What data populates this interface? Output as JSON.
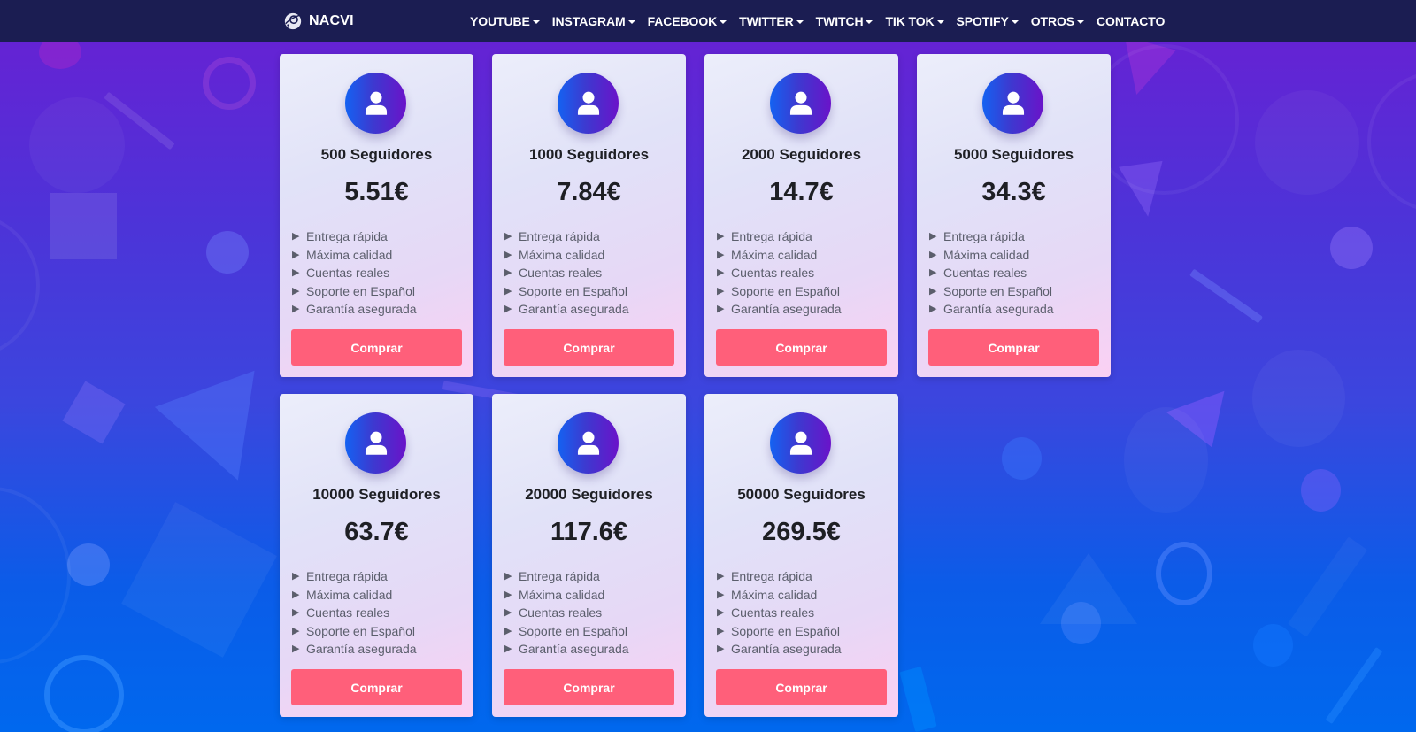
{
  "navbar": {
    "brand": {
      "icon": "planet-logo-icon",
      "label": "NACVI"
    },
    "links": [
      {
        "label": "YOUTUBE",
        "dropdown": true
      },
      {
        "label": "INSTAGRAM",
        "dropdown": true
      },
      {
        "label": "FACEBOOK",
        "dropdown": true
      },
      {
        "label": "TWITTER",
        "dropdown": true
      },
      {
        "label": "TWITCH",
        "dropdown": true
      },
      {
        "label": "TIK TOK",
        "dropdown": true
      },
      {
        "label": "SPOTIFY",
        "dropdown": true
      },
      {
        "label": "OTROS",
        "dropdown": true
      },
      {
        "label": "CONTACTO",
        "dropdown": false
      }
    ]
  },
  "colors": {
    "navbar_bg": "#1b1d52",
    "button": "#ff5f7a",
    "avatar_from": "#1462f2",
    "avatar_to": "#6a13c9"
  },
  "cards": [
    {
      "icon": "user-icon",
      "title": "500 Seguidores",
      "price": "5.51€",
      "features": [
        "Entrega rápida",
        "Máxima calidad",
        "Cuentas reales",
        "Soporte en Español",
        "Garantía asegurada"
      ],
      "button": "Comprar"
    },
    {
      "icon": "user-icon",
      "title": "1000 Seguidores",
      "price": "7.84€",
      "features": [
        "Entrega rápida",
        "Máxima calidad",
        "Cuentas reales",
        "Soporte en Español",
        "Garantía asegurada"
      ],
      "button": "Comprar"
    },
    {
      "icon": "user-icon",
      "title": "2000 Seguidores",
      "price": "14.7€",
      "features": [
        "Entrega rápida",
        "Máxima calidad",
        "Cuentas reales",
        "Soporte en Español",
        "Garantía asegurada"
      ],
      "button": "Comprar"
    },
    {
      "icon": "user-icon",
      "title": "5000 Seguidores",
      "price": "34.3€",
      "features": [
        "Entrega rápida",
        "Máxima calidad",
        "Cuentas reales",
        "Soporte en Español",
        "Garantía asegurada"
      ],
      "button": "Comprar"
    },
    {
      "icon": "user-icon",
      "title": "10000 Seguidores",
      "price": "63.7€",
      "features": [
        "Entrega rápida",
        "Máxima calidad",
        "Cuentas reales",
        "Soporte en Español",
        "Garantía asegurada"
      ],
      "button": "Comprar"
    },
    {
      "icon": "user-icon",
      "title": "20000 Seguidores",
      "price": "117.6€",
      "features": [
        "Entrega rápida",
        "Máxima calidad",
        "Cuentas reales",
        "Soporte en Español",
        "Garantía asegurada"
      ],
      "button": "Comprar"
    },
    {
      "icon": "user-icon",
      "title": "50000 Seguidores",
      "price": "269.5€",
      "features": [
        "Entrega rápida",
        "Máxima calidad",
        "Cuentas reales",
        "Soporte en Español",
        "Garantía asegurada"
      ],
      "button": "Comprar"
    }
  ],
  "feature_bullet_icon": "triangle-right-icon"
}
